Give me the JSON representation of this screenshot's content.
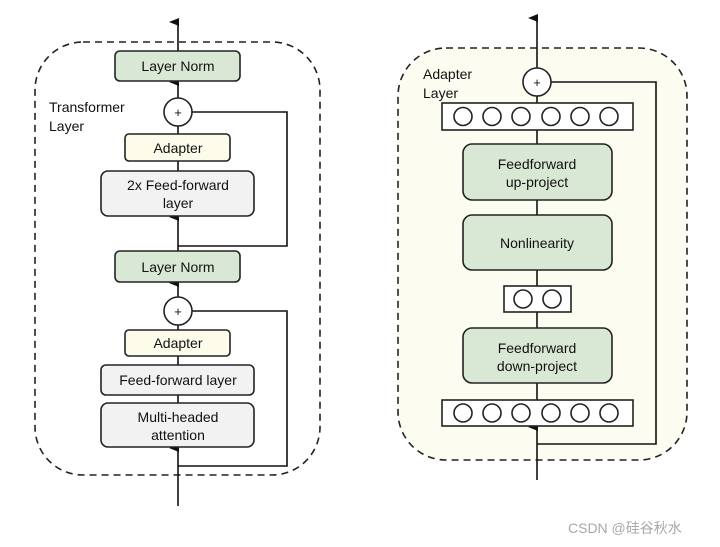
{
  "colors": {
    "norm_green": "#d9e8d4",
    "adapter_yellow": "#fdfbea",
    "ff_gray": "#f2f2f2",
    "adapter_layer_bg": "#fdfcf0"
  },
  "transformer": {
    "title_line1": "Transformer",
    "title_line2": "Layer",
    "layer_norm_top": "Layer Norm",
    "plus_top": "+",
    "adapter_top": "Adapter",
    "ff2x_line1": "2x Feed-forward",
    "ff2x_line2": "layer",
    "layer_norm_bottom": "Layer Norm",
    "plus_bottom": "+",
    "adapter_bottom": "Adapter",
    "ff_layer": "Feed-forward layer",
    "mha_line1": "Multi-headed",
    "mha_line2": "attention"
  },
  "adapter": {
    "title_line1": "Adapter",
    "title_line2": "Layer",
    "plus": "+",
    "up_line1": "Feedforward",
    "up_line2": "up-project",
    "nonlinearity": "Nonlinearity",
    "down_line1": "Feedforward",
    "down_line2": "down-project"
  },
  "watermark": "CSDN @硅谷秋水"
}
